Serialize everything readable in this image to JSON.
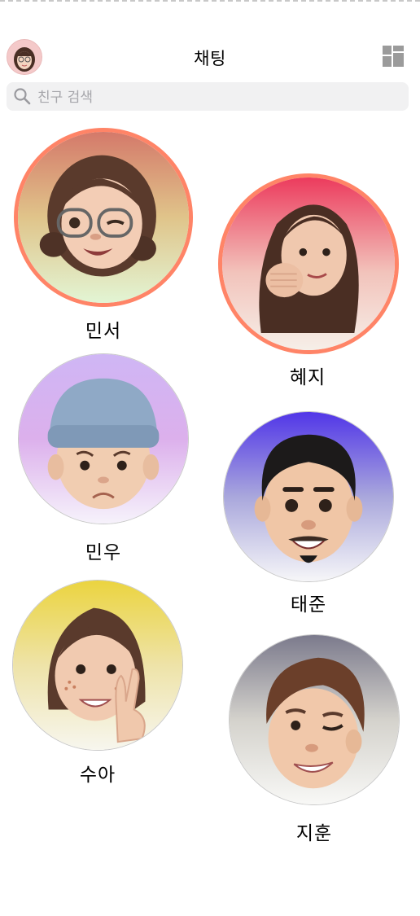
{
  "header": {
    "title": "채팅"
  },
  "search": {
    "placeholder": "친구 검색"
  },
  "friends": [
    {
      "name": "민서"
    },
    {
      "name": "혜지"
    },
    {
      "name": "민우"
    },
    {
      "name": "태준"
    },
    {
      "name": "수아"
    },
    {
      "name": "지훈"
    }
  ],
  "icons": {
    "profile": "my-avatar",
    "layout": "grid-layout-icon",
    "search": "search-icon"
  },
  "colors": {
    "ring": "#ff8467",
    "search_bg": "#f1f1f2",
    "placeholder": "#a6a6ab"
  }
}
